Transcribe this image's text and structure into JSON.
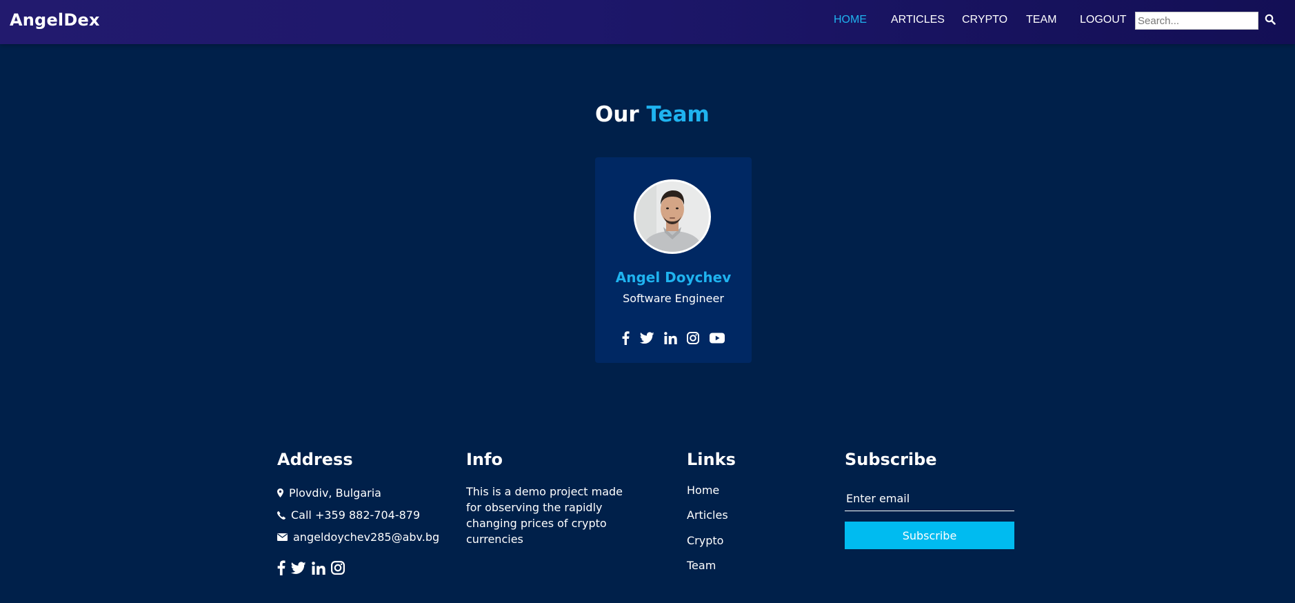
{
  "header": {
    "brand": "AngelDex",
    "nav": [
      {
        "label": "HOME",
        "active": true
      },
      {
        "label": "ARTICLES",
        "active": false
      },
      {
        "label": "CRYPTO",
        "active": false
      },
      {
        "label": "TEAM",
        "active": false
      },
      {
        "label": "LOGOUT",
        "active": false
      }
    ],
    "search_placeholder": "Search...",
    "search_icon": "search-icon"
  },
  "team": {
    "title_part1": "Our",
    "title_part2": "Team",
    "members": [
      {
        "name": "Angel Doychev",
        "role": "Software Engineer",
        "social_icons": [
          "facebook-icon",
          "twitter-icon",
          "linkedin-icon",
          "instagram-icon",
          "youtube-icon"
        ]
      }
    ]
  },
  "footer": {
    "address": {
      "heading": "Address",
      "location": "Plovdiv, Bulgaria",
      "phone": "Call +359 882-704-879",
      "email": "angeldoychev285@abv.bg",
      "social_icons": [
        "facebook-icon",
        "twitter-icon",
        "linkedin-icon",
        "instagram-icon"
      ]
    },
    "info": {
      "heading": "Info",
      "text": "This is a demo project made for observing the rapidly changing prices of crypto currencies"
    },
    "links": {
      "heading": "Links",
      "items": [
        "Home",
        "Articles",
        "Crypto",
        "Team"
      ]
    },
    "subscribe": {
      "heading": "Subscribe",
      "email_placeholder": "Enter email",
      "button_label": "Subscribe"
    }
  },
  "colors": {
    "background": "#00204a",
    "accent": "#1fb3ef",
    "card": "#002863",
    "button": "#00bbf0"
  }
}
